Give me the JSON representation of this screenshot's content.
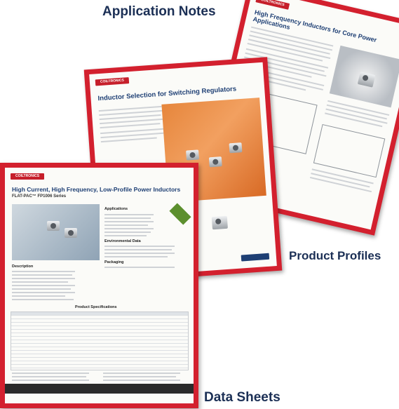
{
  "labels": {
    "application_notes": "Application Notes",
    "product_profiles": "Product Profiles",
    "data_sheets": "Data Sheets"
  },
  "sheets": {
    "application_note": {
      "logo": "COILTRONICS",
      "title": "High Frequency Inductors for Core Power Applications"
    },
    "product_profile": {
      "logo": "COILTRONICS",
      "title": "Inductor Selection for Switching Regulators"
    },
    "data_sheet": {
      "logo": "COILTRONICS",
      "title": "High Current, High Frequency, Low-Profile Power Inductors",
      "subtitle": "FLAT-PAC™ FP1006 Series",
      "section_applications": "Applications",
      "section_environmental": "Environmental Data",
      "section_packaging": "Packaging",
      "section_description": "Description",
      "table_title": "Product Specifications"
    }
  },
  "colors": {
    "frame_red": "#d3202e",
    "title_blue": "#1e3f74",
    "label_navy": "#1b2f55"
  }
}
